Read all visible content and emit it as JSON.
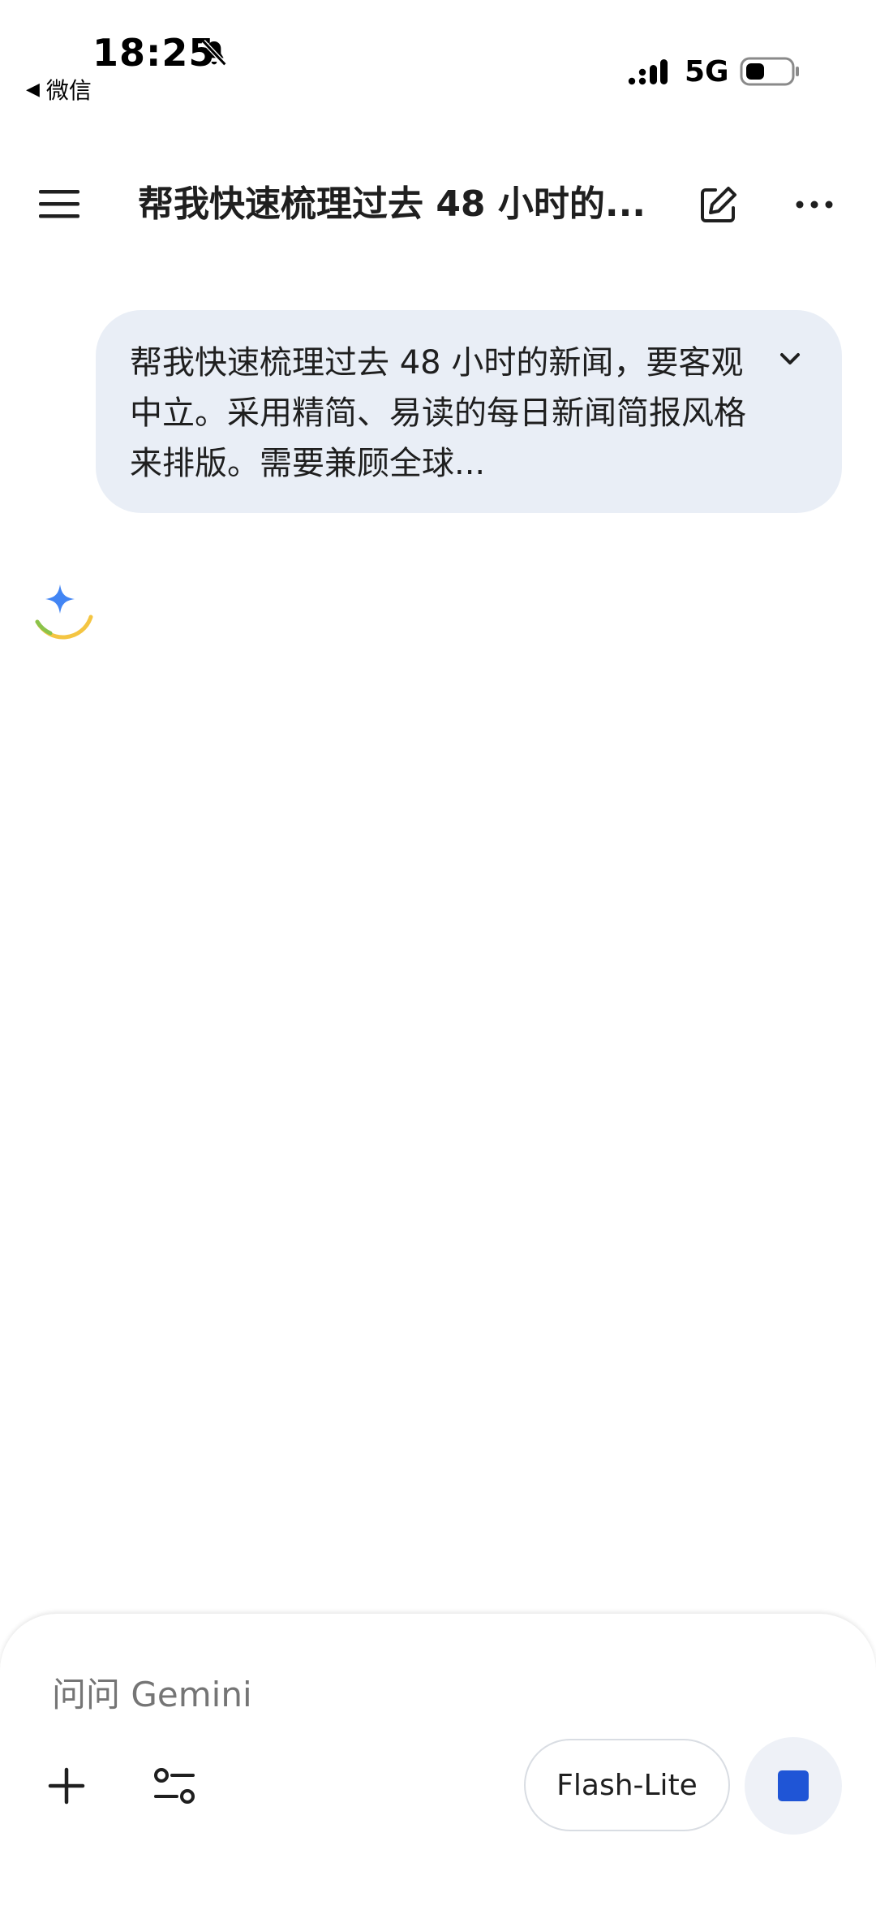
{
  "status_bar": {
    "time": "18:25",
    "back_app": "微信",
    "network": "5G"
  },
  "header": {
    "title": "帮我快速梳理过去 48 小时的..."
  },
  "user_message": {
    "text": "帮我快速梳理过去 48 小时的新闻，要客观中立。采用精简、易读的每日新闻简报风格来排版。需要兼顾全球..."
  },
  "input": {
    "placeholder": "问问 Gemini",
    "model_label": "Flash-Lite"
  },
  "colors": {
    "bubble": "#e9eef6",
    "stop": "#1f55d6",
    "spark_blue": "#4285f4",
    "loader_yellow": "#f4c542",
    "loader_green": "#8bc34a"
  },
  "icons": {
    "bell": "bell-off-icon",
    "signal": "signal-icon",
    "battery": "battery-icon",
    "menu": "menu-icon",
    "edit": "edit-icon",
    "more": "more-icon",
    "chevron": "chevron-down-icon",
    "plus": "plus-icon",
    "tools": "tools-icon",
    "stop": "stop-icon",
    "loader": "gemini-spark-icon"
  }
}
